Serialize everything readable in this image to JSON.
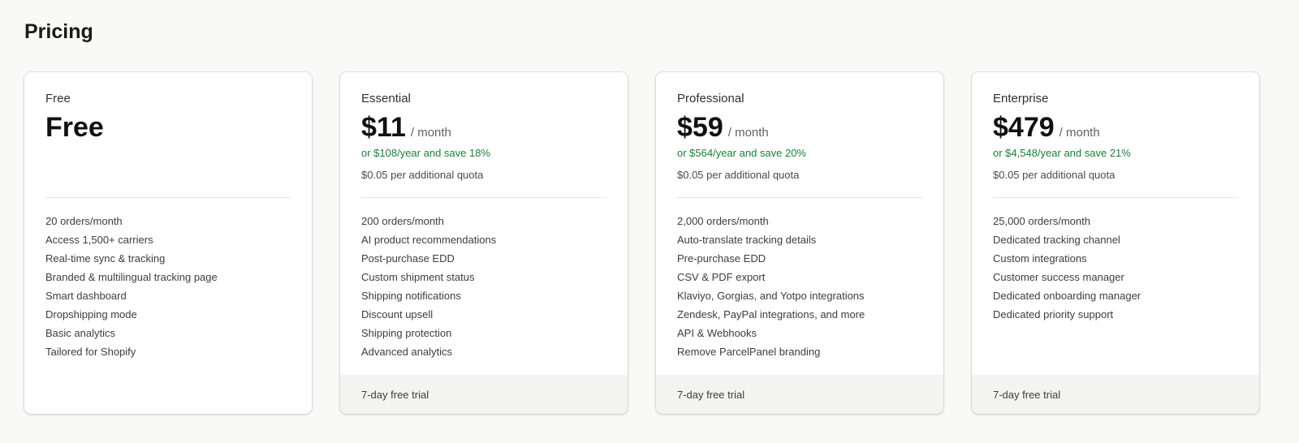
{
  "page": {
    "title": "Pricing"
  },
  "colors": {
    "background": "#f9f9f8",
    "card": "#ffffff",
    "savings_text": "#1a7f37",
    "footer": "#f3f3f2"
  },
  "plans": [
    {
      "name": "Free",
      "price": "Free",
      "period": "",
      "annual": "",
      "quota": "",
      "features": [
        "20 orders/month",
        "Access 1,500+ carriers",
        "Real-time sync & tracking",
        "Branded & multilingual tracking page",
        "Smart dashboard",
        "Dropshipping mode",
        "Basic analytics",
        "Tailored for Shopify"
      ],
      "footer": ""
    },
    {
      "name": "Essential",
      "price": "$11",
      "period": "/ month",
      "annual": "or $108/year and save 18%",
      "quota": "$0.05 per additional quota",
      "features": [
        "200 orders/month",
        "AI product recommendations",
        "Post-purchase EDD",
        "Custom shipment status",
        "Shipping notifications",
        "Discount upsell",
        "Shipping protection",
        "Advanced analytics"
      ],
      "footer": "7-day free trial"
    },
    {
      "name": "Professional",
      "price": "$59",
      "period": "/ month",
      "annual": "or $564/year and save 20%",
      "quota": "$0.05 per additional quota",
      "features": [
        "2,000 orders/month",
        "Auto-translate tracking details",
        "Pre-purchase EDD",
        "CSV & PDF export",
        "Klaviyo, Gorgias, and Yotpo integrations",
        "Zendesk, PayPal integrations, and more",
        "API & Webhooks",
        "Remove ParcelPanel branding"
      ],
      "footer": "7-day free trial"
    },
    {
      "name": "Enterprise",
      "price": "$479",
      "period": "/ month",
      "annual": "or $4,548/year and save 21%",
      "quota": "$0.05 per additional quota",
      "features": [
        "25,000 orders/month",
        "Dedicated tracking channel",
        "Custom integrations",
        "Customer success manager",
        "Dedicated onboarding manager",
        "Dedicated priority support"
      ],
      "footer": "7-day free trial"
    }
  ]
}
